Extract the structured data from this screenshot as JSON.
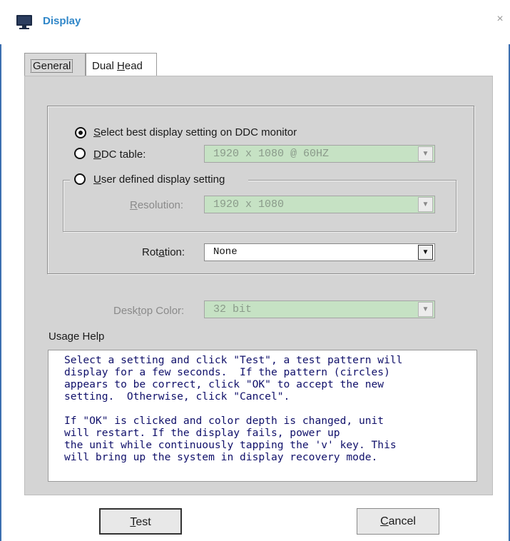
{
  "window": {
    "title": "Display",
    "close_glyph": "×",
    "icon": "monitor-icon"
  },
  "tabs": [
    {
      "label_pre": "General",
      "selected": true
    },
    {
      "label_pre": "Dual ",
      "label_u": "H",
      "label_post": "ead",
      "selected": false
    }
  ],
  "options": {
    "best": {
      "label_pre": "",
      "label_u": "S",
      "label_post": "elect best display setting on DDC monitor",
      "checked": true
    },
    "ddc": {
      "label_pre": "",
      "label_u": "D",
      "label_post": "DC table:",
      "checked": false,
      "value": "1920 x 1080 @ 60HZ"
    },
    "user": {
      "label_pre": "",
      "label_u": "U",
      "label_post": "ser defined display setting",
      "checked": false
    },
    "resolution": {
      "label_pre": "",
      "label_u": "R",
      "label_post": "esolution:",
      "value": "1920 x 1080"
    },
    "rotation": {
      "label_pre": "Rot",
      "label_u": "a",
      "label_post": "tion:",
      "value": "None"
    },
    "desktop_color": {
      "label_pre": "Desk",
      "label_u": "t",
      "label_post": "op Color:",
      "value": "32 bit"
    }
  },
  "help": {
    "label": "Usage Help",
    "text": "Select a setting and click \"Test\", a test pattern will\ndisplay for a few seconds.  If the pattern (circles)\nappears to be correct, click \"OK\" to accept the new\nsetting.  Otherwise, click \"Cancel\".\n\nIf \"OK\" is clicked and color depth is changed, unit\nwill restart. If the display fails, power up\nthe unit while continuously tapping the 'v' key. This\nwill bring up the system in display recovery mode."
  },
  "buttons": {
    "test": {
      "label_u": "T",
      "label_post": "est"
    },
    "cancel": {
      "label_u": "C",
      "label_post": "ancel"
    }
  },
  "dropdown_glyph": "▼",
  "colors": {
    "title": "#2f86c8",
    "disabled_field": "#c6e2c4",
    "help_text": "#10106a",
    "frame": "#3c6fb0"
  }
}
